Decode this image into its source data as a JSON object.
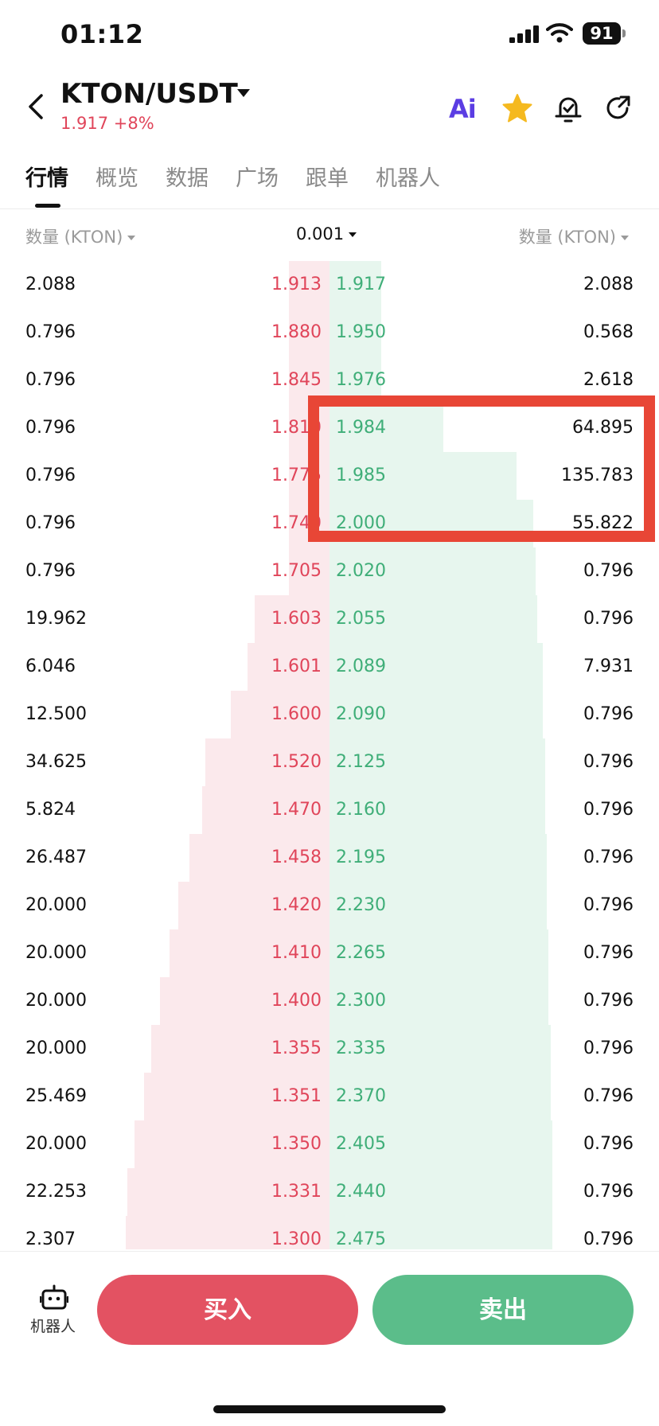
{
  "status_bar": {
    "time": "01:12",
    "battery": "91"
  },
  "header": {
    "pair": "KTON/USDT",
    "price_change": "1.917 +8%",
    "ai_label": "Ai",
    "accent_color": "#e0455a",
    "icons": [
      "back-icon",
      "ai-icon",
      "star-icon",
      "price-alert-icon",
      "share-icon"
    ]
  },
  "tabs": [
    {
      "label": "行情",
      "active": true
    },
    {
      "label": "概览",
      "active": false
    },
    {
      "label": "数据",
      "active": false
    },
    {
      "label": "广场",
      "active": false
    },
    {
      "label": "跟单",
      "active": false
    },
    {
      "label": "机器人",
      "active": false
    }
  ],
  "orderbook": {
    "left_header": "数量 (KTON)",
    "precision": "0.001",
    "right_header": "数量 (KTON)",
    "bid_color": "#e0455a",
    "ask_color": "#3fae78",
    "rows": [
      {
        "bid_qty": "2.088",
        "bid_price": "1.913",
        "ask_price": "1.917",
        "ask_qty": "2.088",
        "bid_depth": 0.1,
        "ask_depth": 0.09
      },
      {
        "bid_qty": "0.796",
        "bid_price": "1.880",
        "ask_price": "1.950",
        "ask_qty": "0.568",
        "bid_depth": 0.1,
        "ask_depth": 0.09
      },
      {
        "bid_qty": "0.796",
        "bid_price": "1.845",
        "ask_price": "1.976",
        "ask_qty": "2.618",
        "bid_depth": 0.1,
        "ask_depth": 0.09
      },
      {
        "bid_qty": "0.796",
        "bid_price": "1.810",
        "ask_price": "1.984",
        "ask_qty": "64.895",
        "bid_depth": 0.1,
        "ask_depth": 0.42
      },
      {
        "bid_qty": "0.796",
        "bid_price": "1.775",
        "ask_price": "1.985",
        "ask_qty": "135.783",
        "bid_depth": 0.1,
        "ask_depth": 0.81
      },
      {
        "bid_qty": "0.796",
        "bid_price": "1.740",
        "ask_price": "2.000",
        "ask_qty": "55.822",
        "bid_depth": 0.1,
        "ask_depth": 0.9
      },
      {
        "bid_qty": "0.796",
        "bid_price": "1.705",
        "ask_price": "2.020",
        "ask_qty": "0.796",
        "bid_depth": 0.1,
        "ask_depth": 0.91
      },
      {
        "bid_qty": "19.962",
        "bid_price": "1.603",
        "ask_price": "2.055",
        "ask_qty": "0.796",
        "bid_depth": 0.29,
        "ask_depth": 0.92
      },
      {
        "bid_qty": "6.046",
        "bid_price": "1.601",
        "ask_price": "2.089",
        "ask_qty": "7.931",
        "bid_depth": 0.33,
        "ask_depth": 0.95
      },
      {
        "bid_qty": "12.500",
        "bid_price": "1.600",
        "ask_price": "2.090",
        "ask_qty": "0.796",
        "bid_depth": 0.42,
        "ask_depth": 0.95
      },
      {
        "bid_qty": "34.625",
        "bid_price": "1.520",
        "ask_price": "2.125",
        "ask_qty": "0.796",
        "bid_depth": 0.56,
        "ask_depth": 0.96
      },
      {
        "bid_qty": "5.824",
        "bid_price": "1.470",
        "ask_price": "2.160",
        "ask_qty": "0.796",
        "bid_depth": 0.58,
        "ask_depth": 0.96
      },
      {
        "bid_qty": "26.487",
        "bid_price": "1.458",
        "ask_price": "2.195",
        "ask_qty": "0.796",
        "bid_depth": 0.65,
        "ask_depth": 0.97
      },
      {
        "bid_qty": "20.000",
        "bid_price": "1.420",
        "ask_price": "2.230",
        "ask_qty": "0.796",
        "bid_depth": 0.71,
        "ask_depth": 0.97
      },
      {
        "bid_qty": "20.000",
        "bid_price": "1.410",
        "ask_price": "2.265",
        "ask_qty": "0.796",
        "bid_depth": 0.76,
        "ask_depth": 0.98
      },
      {
        "bid_qty": "20.000",
        "bid_price": "1.400",
        "ask_price": "2.300",
        "ask_qty": "0.796",
        "bid_depth": 0.81,
        "ask_depth": 0.98
      },
      {
        "bid_qty": "20.000",
        "bid_price": "1.355",
        "ask_price": "2.335",
        "ask_qty": "0.796",
        "bid_depth": 0.86,
        "ask_depth": 0.99
      },
      {
        "bid_qty": "25.469",
        "bid_price": "1.351",
        "ask_price": "2.370",
        "ask_qty": "0.796",
        "bid_depth": 0.9,
        "ask_depth": 0.99
      },
      {
        "bid_qty": "20.000",
        "bid_price": "1.350",
        "ask_price": "2.405",
        "ask_qty": "0.796",
        "bid_depth": 0.95,
        "ask_depth": 1.0
      },
      {
        "bid_qty": "22.253",
        "bid_price": "1.331",
        "ask_price": "2.440",
        "ask_qty": "0.796",
        "bid_depth": 0.99,
        "ask_depth": 1.0
      },
      {
        "bid_qty": "2.307",
        "bid_price": "1.300",
        "ask_price": "2.475",
        "ask_qty": "0.796",
        "bid_depth": 1.0,
        "ask_depth": 1.0
      }
    ]
  },
  "footer": {
    "robot_label": "机器人",
    "buy_label": "买入",
    "sell_label": "卖出",
    "buy_color": "#e35262",
    "sell_color": "#5bbd8a"
  }
}
